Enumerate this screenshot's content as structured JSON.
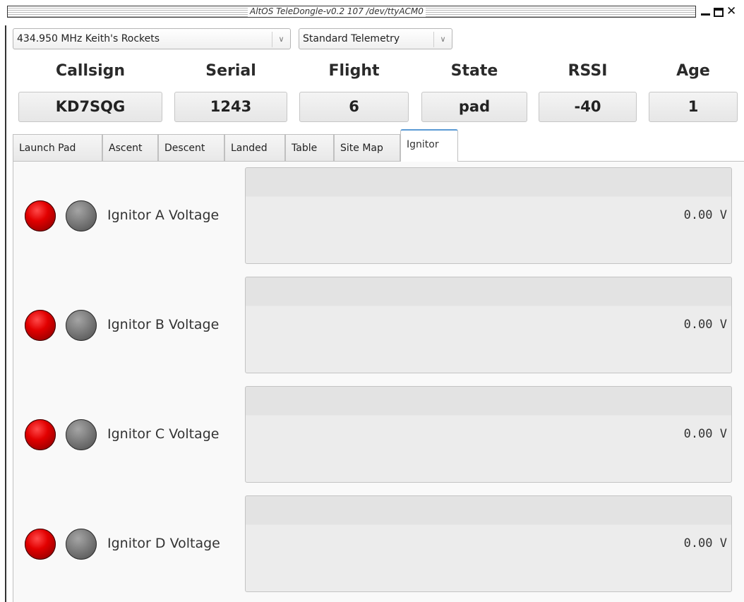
{
  "window": {
    "title": "AltOS TeleDongle-v0.2 107 /dev/ttyACM0"
  },
  "controls": {
    "frequency": "434.950 MHz Keith's Rockets",
    "telemetry_format": "Standard Telemetry"
  },
  "status_header": {
    "fields": [
      {
        "label": "Callsign",
        "value": "KD7SQG"
      },
      {
        "label": "Serial",
        "value": "1243"
      },
      {
        "label": "Flight",
        "value": "6"
      },
      {
        "label": "State",
        "value": "pad"
      },
      {
        "label": "RSSI",
        "value": "-40"
      },
      {
        "label": "Age",
        "value": "1"
      }
    ]
  },
  "tabs": {
    "items": [
      {
        "label": "Launch Pad"
      },
      {
        "label": "Ascent"
      },
      {
        "label": "Descent"
      },
      {
        "label": "Landed"
      },
      {
        "label": "Table"
      },
      {
        "label": "Site Map"
      },
      {
        "label": "Ignitor"
      }
    ],
    "active": "Ignitor"
  },
  "ignitors": [
    {
      "label": "Ignitor A Voltage",
      "value": "0.00 V",
      "indicator_1": "red",
      "indicator_2": "gray"
    },
    {
      "label": "Ignitor B Voltage",
      "value": "0.00 V",
      "indicator_1": "red",
      "indicator_2": "gray"
    },
    {
      "label": "Ignitor C Voltage",
      "value": "0.00 V",
      "indicator_1": "red",
      "indicator_2": "gray"
    },
    {
      "label": "Ignitor D Voltage",
      "value": "0.00 V",
      "indicator_1": "red",
      "indicator_2": "gray"
    }
  ],
  "colors": {
    "led_on": "#e20000",
    "led_off": "#7b7b7b",
    "active_tab_accent": "#5b9bd5"
  },
  "icons": {
    "minimize": "minimize-icon",
    "maximize": "maximize-icon",
    "close": "close-icon",
    "dropdown": "chevron-down-icon"
  }
}
